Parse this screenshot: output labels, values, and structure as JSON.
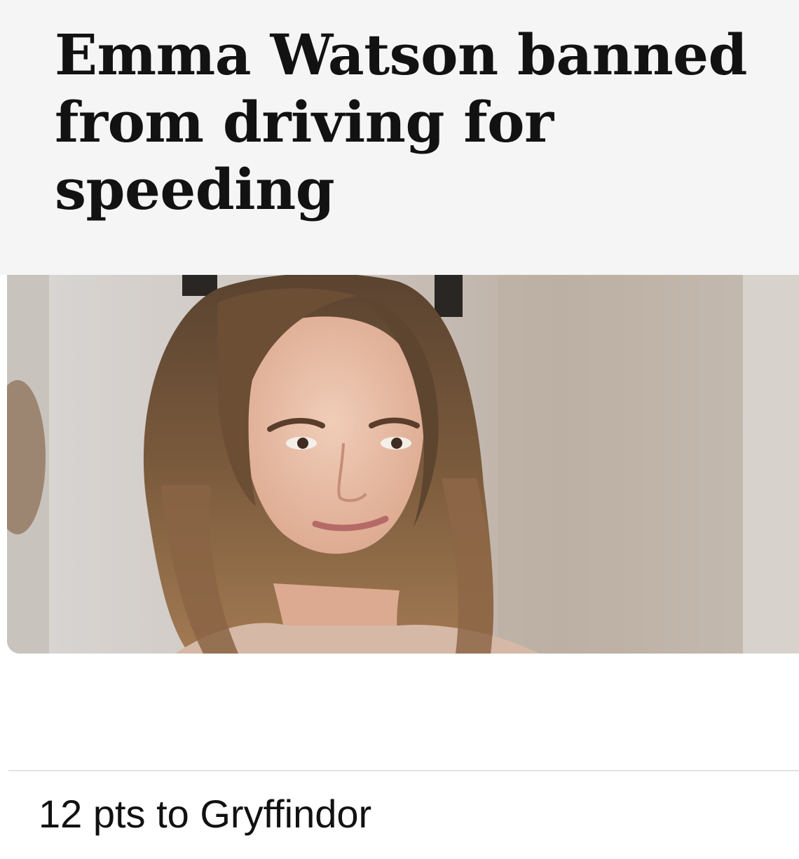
{
  "article": {
    "headline": "Emma Watson banned from driving for speeding"
  },
  "photo": {
    "subject": "woman-portrait"
  },
  "comment": {
    "text": "12 pts to Gryffindor"
  },
  "colors": {
    "headline_bg": "#f5f5f5",
    "headline_text": "#121212",
    "divider": "#e3e3e3",
    "caption_text": "#111111"
  }
}
